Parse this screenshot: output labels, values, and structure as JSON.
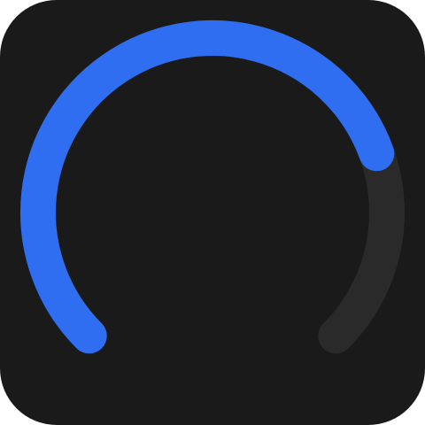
{
  "gauge": {
    "level_fraction": 0.76,
    "start_angle_deg": 135,
    "sweep_deg": 270,
    "colors": {
      "background": "#1a1a1a",
      "track": "#2a2a2a",
      "progress": "#2f6ef0"
    },
    "icon": "arc-gauge-icon"
  }
}
